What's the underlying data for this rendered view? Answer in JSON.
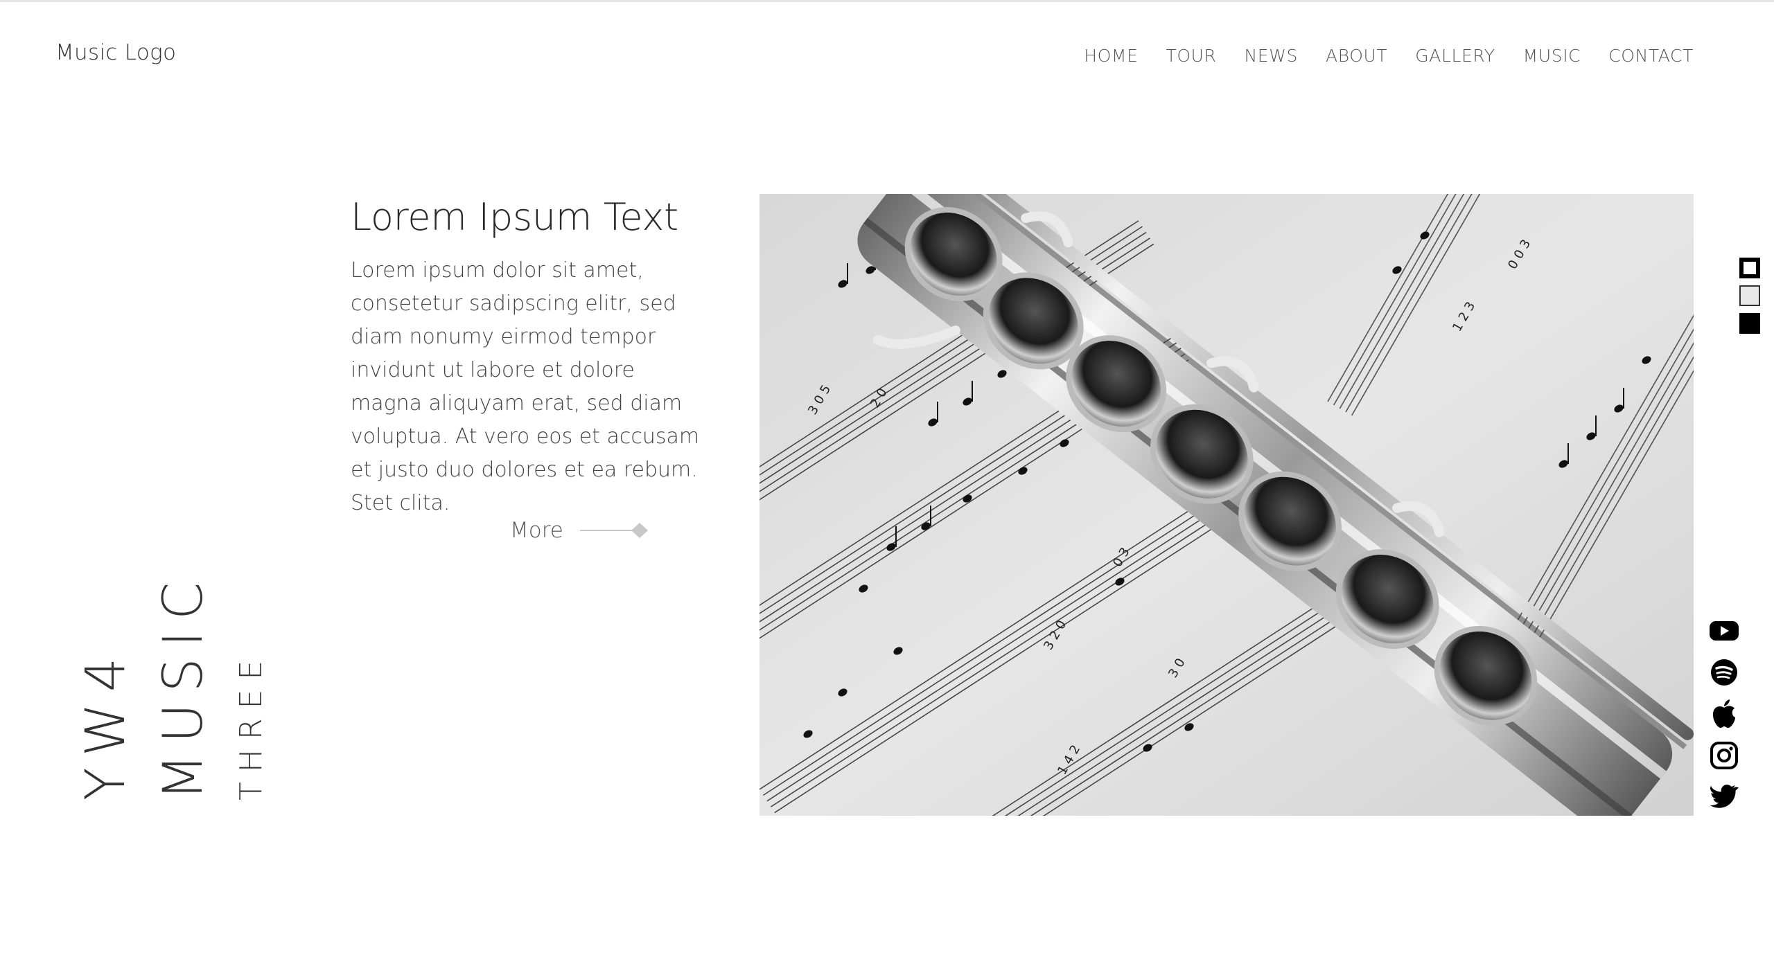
{
  "header": {
    "logo": "Music Logo",
    "nav": [
      "HOME",
      "TOUR",
      "NEWS",
      "ABOUT",
      "GALLERY",
      "MUSIC",
      "CONTACT"
    ]
  },
  "intro": {
    "headline": "Lorem Ipsum Text",
    "body": "Lorem ipsum dolor sit amet, consetetur sadipscing elitr, sed diam nonumy eirmod tempor invidunt ut labore et dolore magna aliquyam erat, sed diam voluptua. At vero eos et accusam et justo duo dolores et ea rebum. Stet clita.",
    "more_label": "More"
  },
  "vertical_title": {
    "line1": "YW4",
    "line2": "MUSIC",
    "line3": "THREE"
  },
  "hero": {
    "subject": "flute on sheet music, black and white photo"
  },
  "theme_switcher": [
    "outlined-square-icon",
    "light-square-icon",
    "filled-square-icon"
  ],
  "social": [
    "youtube-icon",
    "spotify-icon",
    "apple-icon",
    "instagram-icon",
    "twitter-icon"
  ],
  "colors": {
    "background": "#ffffff",
    "text": "#333333",
    "accent": "#cccccc"
  }
}
